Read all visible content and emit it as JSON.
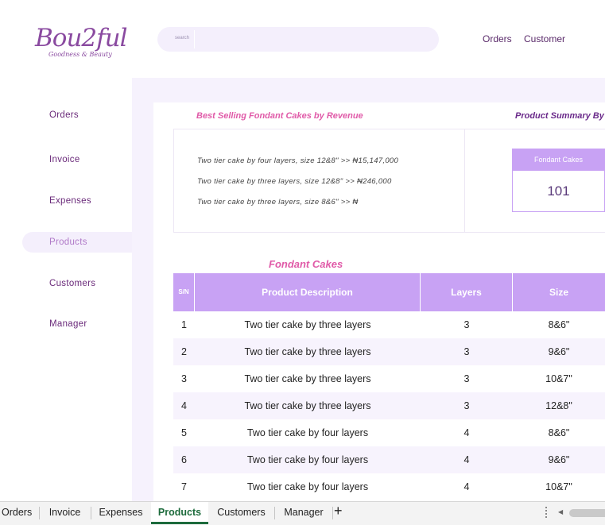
{
  "logo": {
    "name": "Bou2ful",
    "tagline": "Goodness & Beauty"
  },
  "search": {
    "label": "search",
    "value": ""
  },
  "top_nav": [
    "Orders",
    "Customer"
  ],
  "sidebar": {
    "items": [
      {
        "label": "Orders"
      },
      {
        "label": "Invoice"
      },
      {
        "label": "Expenses"
      },
      {
        "label": "Products"
      },
      {
        "label": "Customers"
      },
      {
        "label": "Manager"
      }
    ],
    "active": "Products"
  },
  "best_selling": {
    "title": "Best Selling Fondant Cakes by Revenue",
    "lines": [
      "Two tier cake by four layers, size 12&8\"  >> ₦15,147,000",
      "Two tier cake by three layers, size 12&8\"  >> ₦246,000",
      "Two tier cake by three layers, size 8&6\"  >> ₦"
    ]
  },
  "summary": {
    "title": "Product Summary By",
    "card_label": "Fondant Cakes",
    "card_value": "101"
  },
  "table": {
    "title": "Fondant Cakes",
    "headers": [
      "S/N",
      "Product Description",
      "Layers",
      "Size"
    ],
    "rows": [
      [
        "1",
        "Two tier cake by three layers",
        "3",
        "8&6\""
      ],
      [
        "2",
        "Two tier cake by three layers",
        "3",
        "9&6\""
      ],
      [
        "3",
        "Two tier cake by three layers",
        "3",
        "10&7\""
      ],
      [
        "4",
        "Two tier cake by three layers",
        "3",
        "12&8\""
      ],
      [
        "5",
        "Two tier cake by four layers",
        "4",
        "8&6\""
      ],
      [
        "6",
        "Two tier cake by four layers",
        "4",
        "9&6\""
      ],
      [
        "7",
        "Two tier cake by four layers",
        "4",
        "10&7\""
      ]
    ]
  },
  "sheet_tabs": {
    "items": [
      "Orders",
      "Invoice",
      "Expenses",
      "Products",
      "Customers",
      "Manager"
    ],
    "active": "Products",
    "add_label": "+"
  },
  "colors": {
    "accent": "#c8a2f4",
    "brand": "#8a4aa0",
    "pink": "#e05aa8",
    "sheet_active": "#1d6b3c"
  },
  "icons": {
    "add_sheet": "plus-icon",
    "scroll_left": "arrow-left-icon"
  }
}
